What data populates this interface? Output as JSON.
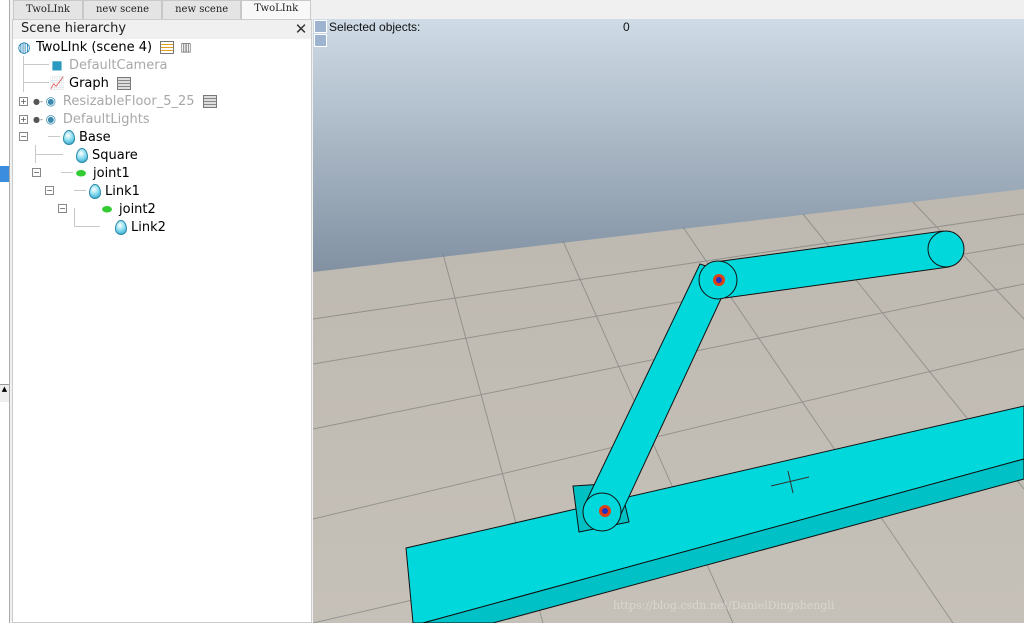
{
  "tabs": [
    "TwoLInk",
    "new scene",
    "new scene",
    "TwoLInk"
  ],
  "active_tab": 3,
  "panel": {
    "title": "Scene hierarchy"
  },
  "tree": {
    "root": "TwoLInk (scene 4)",
    "items": [
      "DefaultCamera",
      "Graph",
      "ResizableFloor_5_25",
      "DefaultLights",
      "Base",
      "Square",
      "joint1",
      "Link1",
      "joint2",
      "Link2"
    ]
  },
  "viewport": {
    "selected_label": "Selected objects:",
    "selected_count": "0",
    "watermark": "https://blog.csdn.net/DanielDingshengli"
  },
  "colors": {
    "link": "#00d8dc",
    "sky_top": "#cfdbe6",
    "sky_bottom": "#7f8fa0"
  }
}
